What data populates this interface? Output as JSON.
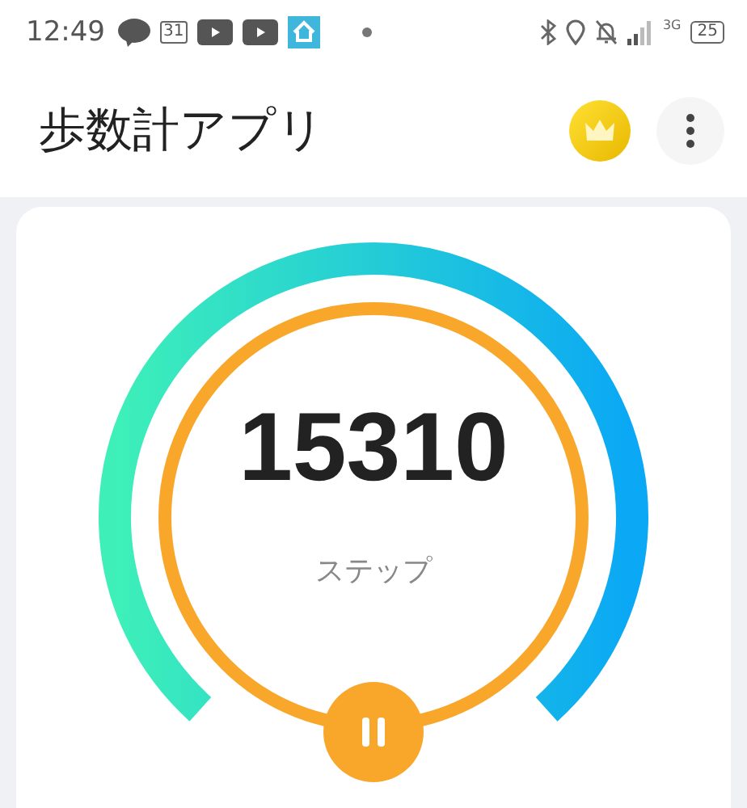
{
  "status_bar": {
    "time": "12:49",
    "calendar_day": "31",
    "network": "3G",
    "battery": "25"
  },
  "app_bar": {
    "title": "歩数計アプリ"
  },
  "step_counter": {
    "count": "15310",
    "unit": "ステップ",
    "paused": false
  }
}
